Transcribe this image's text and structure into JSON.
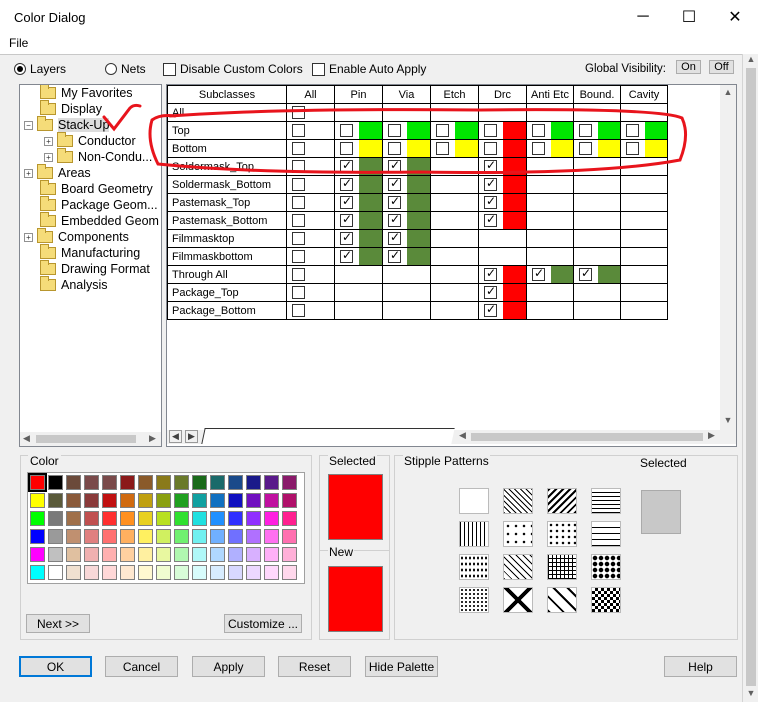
{
  "window": {
    "title": "Color Dialog",
    "minimize_glyph": "─",
    "maximize_glyph": "☐",
    "close_glyph": "✕"
  },
  "menu": {
    "file": "File"
  },
  "options": {
    "layers_label": "Layers",
    "nets_label": "Nets",
    "disable_custom_colors": "Disable Custom Colors",
    "enable_auto_apply": "Enable Auto Apply",
    "global_visibility_label": "Global Visibility:",
    "on_label": "On",
    "off_label": "Off"
  },
  "tree": {
    "items": [
      {
        "label": "My Favorites"
      },
      {
        "label": "Display"
      },
      {
        "label": "Stack-Up"
      },
      {
        "label": "Conductor"
      },
      {
        "label": "Non-Condu..."
      },
      {
        "label": "Areas"
      },
      {
        "label": "Board Geometry"
      },
      {
        "label": "Package Geom..."
      },
      {
        "label": "Embedded Geom"
      },
      {
        "label": "Components"
      },
      {
        "label": "Manufacturing"
      },
      {
        "label": "Drawing Format"
      },
      {
        "label": "Analysis"
      }
    ]
  },
  "grid": {
    "headers": [
      "Subclasses",
      "All",
      "Pin",
      "Via",
      "Etch",
      "Drc",
      "Anti Etc",
      "Bound.",
      "Cavity"
    ],
    "rows": [
      {
        "name": "All"
      },
      {
        "name": "Top"
      },
      {
        "name": "Bottom"
      },
      {
        "name": "Soldermask_Top"
      },
      {
        "name": "Soldermask_Bottom"
      },
      {
        "name": "Pastemask_Top"
      },
      {
        "name": "Pastemask_Bottom"
      },
      {
        "name": "Filmmasktop"
      },
      {
        "name": "Filmmaskbottom"
      },
      {
        "name": "Through All"
      },
      {
        "name": "Package_Top"
      },
      {
        "name": "Package_Bottom"
      }
    ]
  },
  "colors": {
    "green": "#00e600",
    "yellow": "#ffff00",
    "dark_green": "#5a8a3a",
    "red": "#ff0000",
    "markup_red": "#e8141c"
  },
  "palette": {
    "title": "Color",
    "next_button": "Next >>",
    "customize_button": "Customize ...",
    "swatches": [
      "#ff0000",
      "#000000",
      "#6b4a3a",
      "#7a4a4a",
      "#7a4a4a",
      "#8b1a1a",
      "#8a5a2a",
      "#8a7a1a",
      "#6a7a2a",
      "#1a6a1a",
      "#1a6a6a",
      "#1a4a8a",
      "#1a1a8a",
      "#5a1a8a",
      "#8a1a6a",
      "#ffff00",
      "#5a5a3a",
      "#8a5a3a",
      "#8a3a3a",
      "#c01010",
      "#d06a10",
      "#c0a010",
      "#8aa010",
      "#20a020",
      "#10a0a0",
      "#1070c0",
      "#1010c0",
      "#7010c0",
      "#c010a0",
      "#b0106a",
      "#00ff00",
      "#7a7a7a",
      "#a0704a",
      "#c05050",
      "#ff3030",
      "#ff9020",
      "#e8d020",
      "#b8e020",
      "#30e030",
      "#20e0e0",
      "#2090ff",
      "#3030ff",
      "#9030ff",
      "#ff20e0",
      "#ff2090",
      "#0000ff",
      "#9a9a9a",
      "#c09070",
      "#e08080",
      "#ff7070",
      "#ffb060",
      "#fff060",
      "#d0f060",
      "#70f070",
      "#70f0f0",
      "#70b0ff",
      "#7070ff",
      "#b070ff",
      "#ff70f0",
      "#ff70b0",
      "#ff00ff",
      "#c0c0c0",
      "#e0c0a0",
      "#f0b0b0",
      "#ffb0b0",
      "#ffd0a0",
      "#fff0a0",
      "#e8f8a0",
      "#b0f8b0",
      "#b0f8f8",
      "#b0d8ff",
      "#b0b0ff",
      "#d8b0ff",
      "#ffb0f8",
      "#ffb0d8",
      "#00ffff",
      "#ffffff",
      "#f0e0d0",
      "#f8d8d8",
      "#ffd8d8",
      "#ffe8d0",
      "#fff8d0",
      "#f0fcd0",
      "#d8fcd8",
      "#d8fcfc",
      "#d8ecff",
      "#d8d8ff",
      "#ecd8ff",
      "#ffd8fc",
      "#ffd8ec"
    ]
  },
  "selected_color": {
    "selected_label": "Selected",
    "new_label": "New",
    "selected_value": "#ff0000",
    "new_value": "#ff0000"
  },
  "stipple": {
    "title": "Stipple Patterns",
    "selected_label": "Selected",
    "selected_swatch": "#c8c8c8"
  },
  "buttons": {
    "ok": "OK",
    "cancel": "Cancel",
    "apply": "Apply",
    "reset": "Reset",
    "hide_palette": "Hide Palette",
    "help": "Help"
  }
}
